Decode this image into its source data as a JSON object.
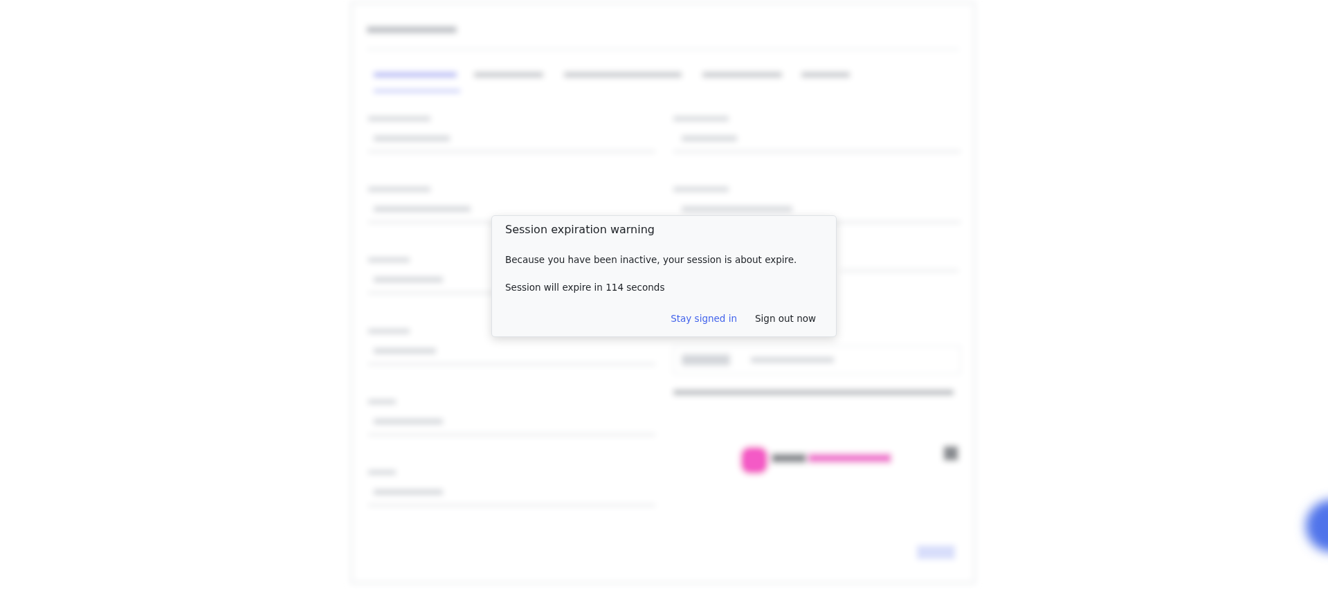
{
  "dialog": {
    "title": "Session expiration warning",
    "paragraphs": [
      "Because you have been inactive, your session is about expire.",
      "Session will expire in 114 seconds"
    ],
    "buttons": [
      {
        "label": "Stay signed in",
        "kind": "primary"
      },
      {
        "label": "Sign out now",
        "kind": "secondary"
      }
    ]
  }
}
